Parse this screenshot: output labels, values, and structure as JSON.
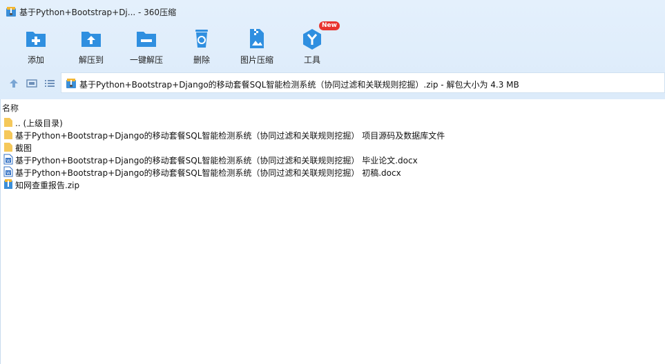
{
  "window": {
    "title": "基于Python+Bootstrap+Dj... - 360压缩",
    "app_icon": "archive-icon"
  },
  "toolbar": {
    "buttons": [
      {
        "label": "添加",
        "icon": "add-folder-icon"
      },
      {
        "label": "解压到",
        "icon": "extract-to-folder-icon"
      },
      {
        "label": "一键解压",
        "icon": "one-click-extract-icon"
      },
      {
        "label": "删除",
        "icon": "recycle-bin-icon"
      },
      {
        "label": "图片压缩",
        "icon": "image-zip-icon"
      },
      {
        "label": "工具",
        "icon": "tools-icon",
        "badge": "New"
      }
    ]
  },
  "navbar": {
    "up_icon": "arrow-up-icon",
    "view_icon": "thumbnail-view-icon",
    "list_icon": "list-view-icon",
    "address": "基于Python+Bootstrap+Django的移动套餐SQL智能检测系统（协同过滤和关联规则挖掘）.zip - 解包大小为 4.3 MB"
  },
  "list": {
    "column_name": "名称",
    "items": [
      {
        "name": ".. (上级目录)",
        "type": "folder"
      },
      {
        "name": "基于Python+Bootstrap+Django的移动套餐SQL智能检测系统（协同过滤和关联规则挖掘） 项目源码及数据库文件",
        "type": "folder"
      },
      {
        "name": "截图",
        "type": "folder"
      },
      {
        "name": "基于Python+Bootstrap+Django的移动套餐SQL智能检测系统（协同过滤和关联规则挖掘） 毕业论文.docx",
        "type": "word"
      },
      {
        "name": "基于Python+Bootstrap+Django的移动套餐SQL智能检测系统（协同过滤和关联规则挖掘） 初稿.docx",
        "type": "word"
      },
      {
        "name": "知网查重报告.zip",
        "type": "zip"
      }
    ]
  },
  "colors": {
    "accent": "#2f8fe0",
    "folder": "#f5c85a",
    "toolbar_bg": "#e2effb"
  }
}
